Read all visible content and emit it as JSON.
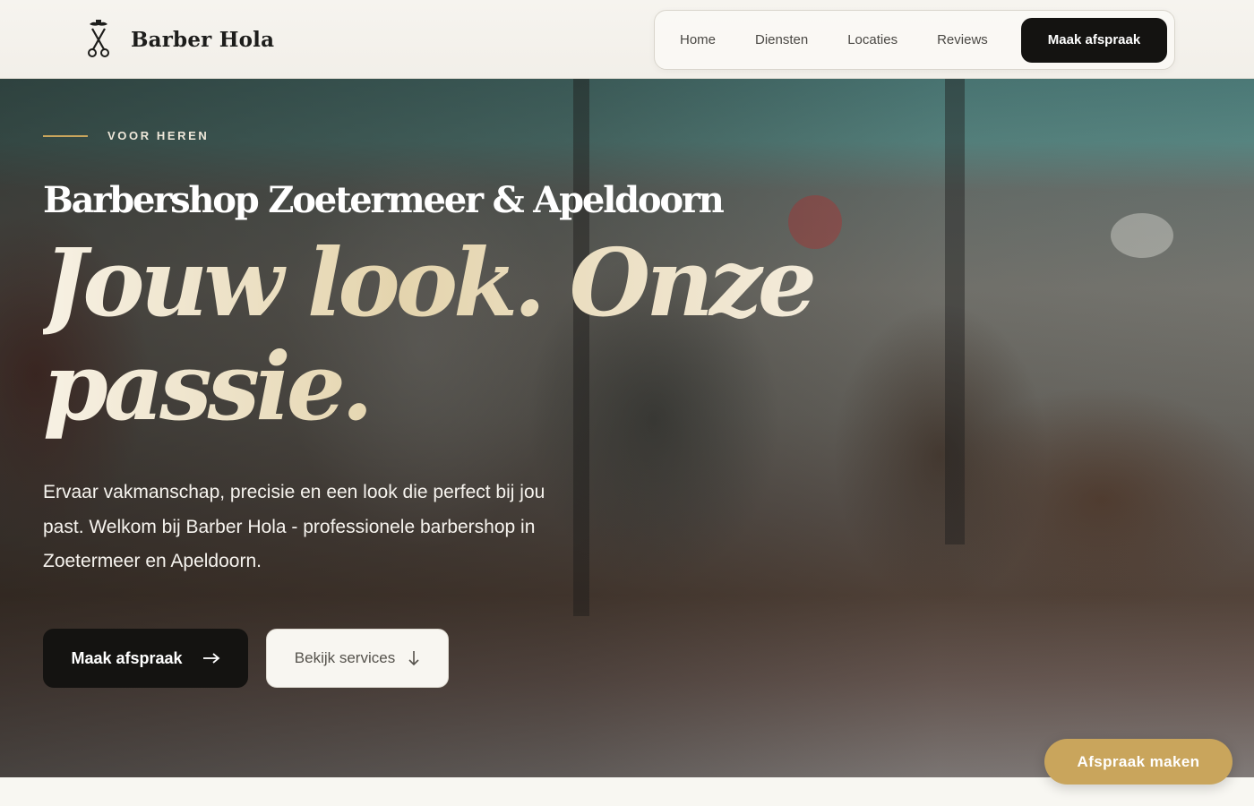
{
  "brand": {
    "name": "Barber Hola",
    "logo_icon": "barber-scissors-mustache-icon"
  },
  "nav": {
    "items": [
      {
        "label": "Home"
      },
      {
        "label": "Diensten"
      },
      {
        "label": "Locaties"
      },
      {
        "label": "Reviews"
      }
    ],
    "cta_label": "Maak afspraak"
  },
  "hero": {
    "eyebrow": "VOOR HEREN",
    "subtitle": "Barbershop Zoetermeer & Apeldoorn",
    "title_line1": "Jouw look. Onze",
    "title_line2": "passie.",
    "text": "Ervaar vakmanschap, precisie en een look die perfect bij jou past. Welkom bij Barber Hola - professionele barbershop in Zoetermeer en Apeldoorn.",
    "primary_button": {
      "label": "Maak afspraak",
      "icon": "arrow-right-icon"
    },
    "secondary_button": {
      "label": "Bekijk services",
      "icon": "arrow-down-icon"
    }
  },
  "floating_cta": {
    "label": "Afspraak maken"
  },
  "colors": {
    "accent_gold": "#c9a55c",
    "dark": "#141311",
    "header_bg": "#f4f2ed"
  }
}
